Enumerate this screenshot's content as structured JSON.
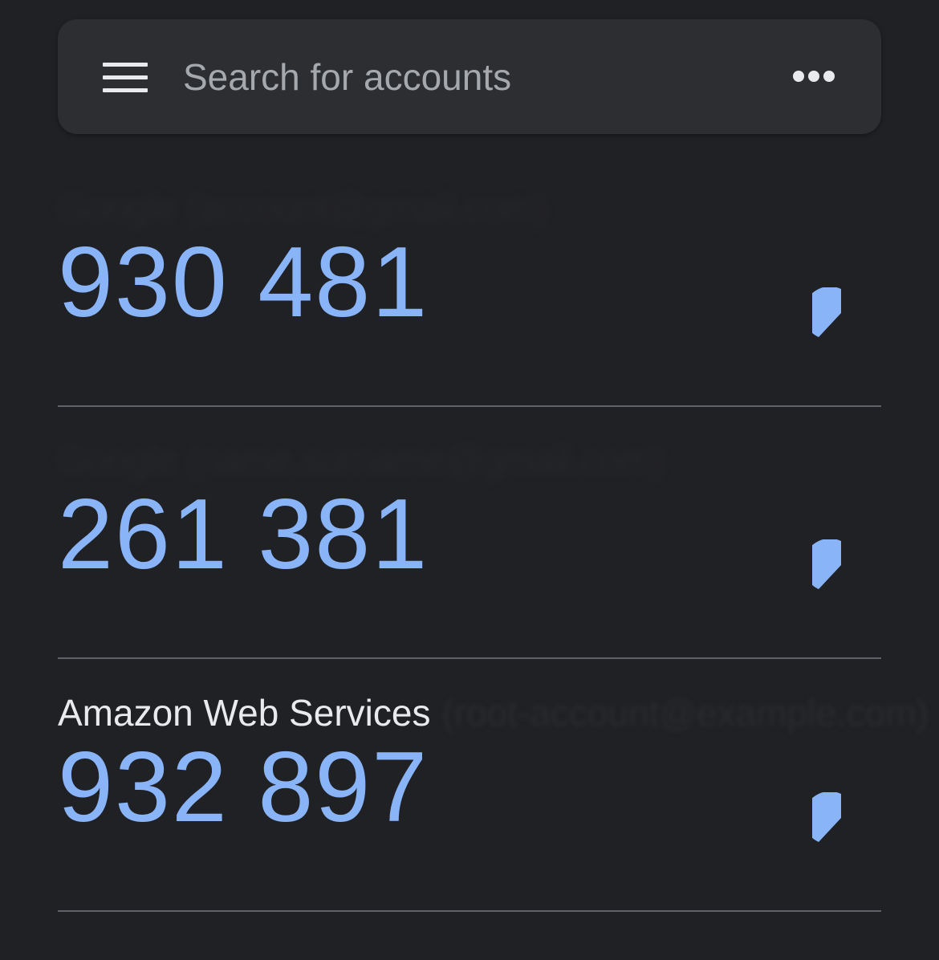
{
  "search": {
    "placeholder": "Search for accounts"
  },
  "icons": {
    "menu": "hamburger-menu-icon",
    "more": "more-horizontal-icon",
    "timer": "countdown-timer-icon"
  },
  "colors": {
    "background": "#202124",
    "search_bar": "#2d2e31",
    "code": "#8ab4f8",
    "timer": "#8ab4f8",
    "divider": "#5f6368"
  },
  "accounts": [
    {
      "issuer": "",
      "code": "930 481",
      "timer_remaining": 0.6
    },
    {
      "issuer": "",
      "code": "261 381",
      "timer_remaining": 0.6
    },
    {
      "issuer": "Amazon Web Services",
      "code": "932 897",
      "timer_remaining": 0.6
    }
  ]
}
